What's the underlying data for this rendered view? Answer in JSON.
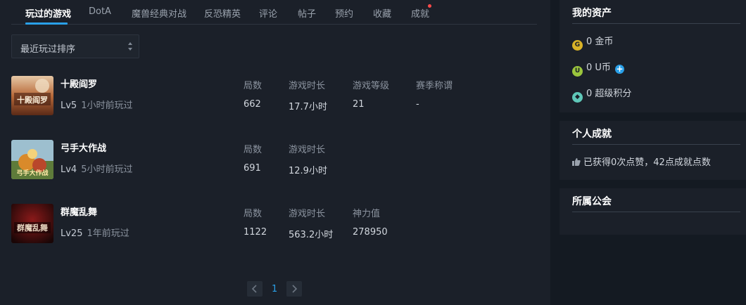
{
  "tabs": [
    {
      "label": "玩过的游戏"
    },
    {
      "label": "DotA"
    },
    {
      "label": "魔兽经典对战"
    },
    {
      "label": "反恐精英"
    },
    {
      "label": "评论"
    },
    {
      "label": "帖子"
    },
    {
      "label": "预约"
    },
    {
      "label": "收藏"
    },
    {
      "label": "成就"
    }
  ],
  "sort": {
    "selected": "最近玩过排序"
  },
  "games": [
    {
      "name": "十殿阎罗",
      "cover_text": "十殿阎罗",
      "level": "Lv5",
      "last_played": "1小时前玩过",
      "stats": [
        {
          "label": "局数",
          "value": "662"
        },
        {
          "label": "游戏时长",
          "value": "17.7小时"
        },
        {
          "label": "游戏等级",
          "value": "21"
        },
        {
          "label": "赛季称谓",
          "value": "-"
        }
      ]
    },
    {
      "name": "弓手大作战",
      "cover_text": "弓手大作战",
      "level": "Lv4",
      "last_played": "5小时前玩过",
      "stats": [
        {
          "label": "局数",
          "value": "691"
        },
        {
          "label": "游戏时长",
          "value": "12.9小时"
        }
      ]
    },
    {
      "name": "群魔乱舞",
      "cover_text": "群魔乱舞",
      "level": "Lv25",
      "last_played": "1年前玩过",
      "stats": [
        {
          "label": "局数",
          "value": "1122"
        },
        {
          "label": "游戏时长",
          "value": "563.2小时"
        },
        {
          "label": "神力值",
          "value": "278950"
        }
      ]
    }
  ],
  "pagination": {
    "current_page": "1"
  },
  "assets": {
    "title": "我的资产",
    "items": [
      {
        "icon": "gold-coin-icon",
        "icon_glyph": "G",
        "color": "#d9b227",
        "text": "0 金币"
      },
      {
        "icon": "u-coin-icon",
        "icon_glyph": "U",
        "color": "#9bc53d",
        "text": "0 U币"
      },
      {
        "icon": "super-points-icon",
        "icon_glyph": "◆",
        "color": "#5fc7b8",
        "text": "0 超级积分"
      }
    ]
  },
  "achievements": {
    "title": "个人成就",
    "summary": "已获得0次点赞，42点成就点数"
  },
  "guild": {
    "title": "所属公会"
  },
  "colors": {
    "accent": "#2aa0e8",
    "notification_dot": "#ff4a4a"
  }
}
